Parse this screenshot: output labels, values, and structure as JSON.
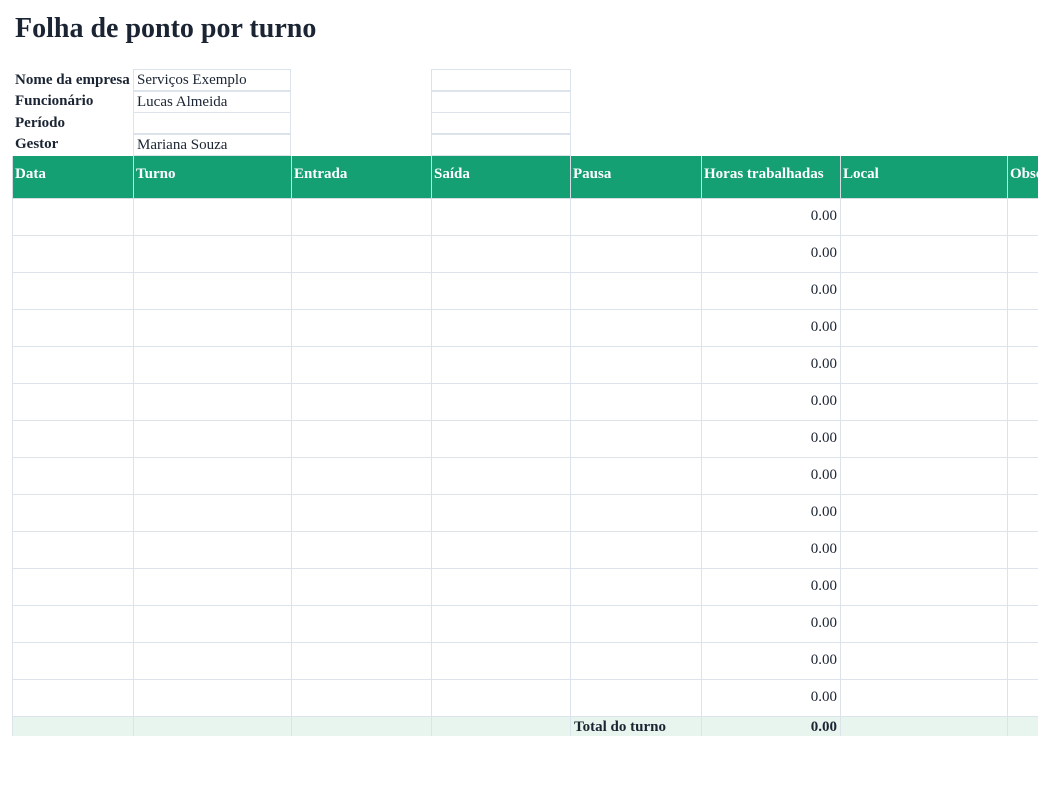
{
  "sheet_title": "Folha de ponto por turno",
  "info": {
    "company_label": "Nome da empresa",
    "company_value": "Serviços Exemplo",
    "employee_label": "Funcionário",
    "employee_value": "Lucas Almeida",
    "period_label": "Período",
    "period_value": "",
    "manager_label": "Gestor",
    "manager_value": "Mariana Souza"
  },
  "columns": [
    "Data",
    "Turno",
    "Entrada",
    "Saída",
    "Pausa",
    "Horas trabalhadas",
    "Local",
    "Observações"
  ],
  "rows": [
    {
      "hours": "0.00"
    },
    {
      "hours": "0.00"
    },
    {
      "hours": "0.00"
    },
    {
      "hours": "0.00"
    },
    {
      "hours": "0.00"
    },
    {
      "hours": "0.00"
    },
    {
      "hours": "0.00"
    },
    {
      "hours": "0.00"
    },
    {
      "hours": "0.00"
    },
    {
      "hours": "0.00"
    },
    {
      "hours": "0.00"
    },
    {
      "hours": "0.00"
    },
    {
      "hours": "0.00"
    },
    {
      "hours": "0.00"
    }
  ],
  "total": {
    "label": "Total do turno",
    "value": "0.00"
  },
  "colors": {
    "header_bg": "#14a073",
    "header_text": "#ffffff",
    "total_bg": "#e8f5ee",
    "grid_line": "#dde3ea"
  }
}
